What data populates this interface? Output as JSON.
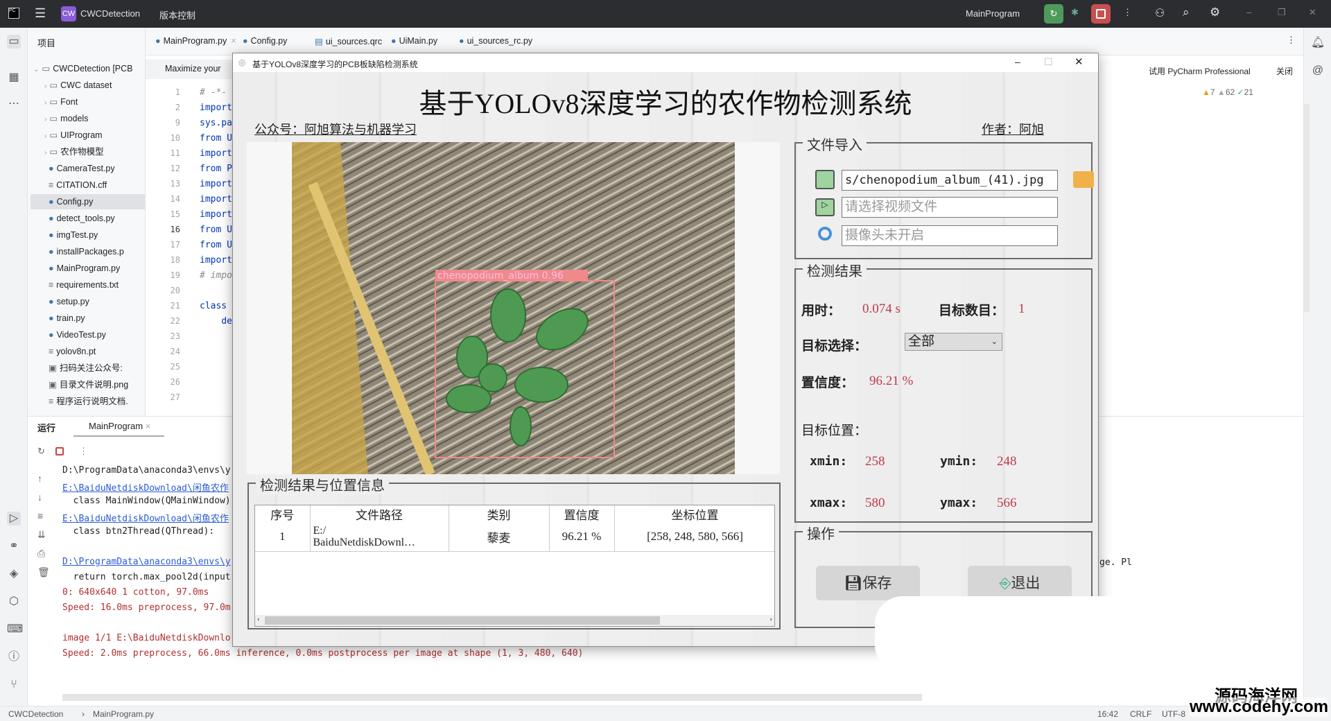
{
  "ide": {
    "project_name": "CWCDetection",
    "vcs": "版本控制",
    "run_config": "MainProgram",
    "project_label": "项目",
    "tree": [
      {
        "label": "CWCDetection [PCB",
        "kind": "root"
      },
      {
        "label": "CWC dataset",
        "kind": "folder"
      },
      {
        "label": "Font",
        "kind": "folder"
      },
      {
        "label": "models",
        "kind": "folder"
      },
      {
        "label": "UIProgram",
        "kind": "folder"
      },
      {
        "label": "农作物模型",
        "kind": "folder"
      },
      {
        "label": "CameraTest.py",
        "kind": "py"
      },
      {
        "label": "CITATION.cff",
        "kind": "txt"
      },
      {
        "label": "Config.py",
        "kind": "py"
      },
      {
        "label": "detect_tools.py",
        "kind": "py"
      },
      {
        "label": "imgTest.py",
        "kind": "py"
      },
      {
        "label": "installPackages.p",
        "kind": "py"
      },
      {
        "label": "MainProgram.py",
        "kind": "py"
      },
      {
        "label": "requirements.txt",
        "kind": "txt"
      },
      {
        "label": "setup.py",
        "kind": "py"
      },
      {
        "label": "train.py",
        "kind": "py"
      },
      {
        "label": "VideoTest.py",
        "kind": "py"
      },
      {
        "label": "yolov8n.pt",
        "kind": "txt"
      },
      {
        "label": "扫码关注公众号:",
        "kind": "img"
      },
      {
        "label": "目录文件说明.png",
        "kind": "img"
      },
      {
        "label": "程序运行说明文档.",
        "kind": "txt"
      }
    ],
    "tabs": [
      "MainProgram.py",
      "Config.py",
      "ui_sources.qrc",
      "UiMain.py",
      "ui_sources_rc.py"
    ],
    "banner": "Maximize your",
    "trial": "试用 PyCharm Professional",
    "close": "关闭",
    "inspections": {
      "warn1": "7",
      "warn2": "62",
      "ok": "21"
    },
    "code_lines": [
      {
        "n": "1",
        "c": "# -*-"
      },
      {
        "n": "2",
        "c": "import"
      },
      {
        "n": "9",
        "c": "sys.pa"
      },
      {
        "n": "10",
        "c": "from U"
      },
      {
        "n": "11",
        "c": "import"
      },
      {
        "n": "12",
        "c": "from P"
      },
      {
        "n": "13",
        "c": "import"
      },
      {
        "n": "14",
        "c": "import"
      },
      {
        "n": "15",
        "c": "import"
      },
      {
        "n": "16",
        "c": "from U"
      },
      {
        "n": "17",
        "c": "from U"
      },
      {
        "n": "18",
        "c": "import"
      },
      {
        "n": "19",
        "c": "# impo"
      },
      {
        "n": "20",
        "c": ""
      },
      {
        "n": "21",
        "c": "class"
      },
      {
        "n": "22",
        "c": "    de"
      },
      {
        "n": "23",
        "c": ""
      },
      {
        "n": "24",
        "c": ""
      },
      {
        "n": "25",
        "c": ""
      },
      {
        "n": "26",
        "c": ""
      },
      {
        "n": "27",
        "c": ""
      }
    ],
    "run_label": "运行",
    "run_tab": "MainProgram",
    "console": [
      {
        "t": "D:\\ProgramData\\anaconda3\\envs\\y",
        "k": ""
      },
      {
        "t": "E:\\BaiduNetdiskDownload\\闲鱼农作",
        "k": "link"
      },
      {
        "t": "  class MainWindow(QMainWindow)",
        "k": ""
      },
      {
        "t": "E:\\BaiduNetdiskDownload\\闲鱼农作",
        "k": "link"
      },
      {
        "t": "  class btn2Thread(QThread):",
        "k": ""
      },
      {
        "t": "",
        "k": ""
      },
      {
        "t": "D:\\ProgramData\\anaconda3\\envs\\y",
        "k": "link"
      },
      {
        "t": "  return torch.max_pool2d(input",
        "k": ""
      },
      {
        "t": "0: 640x640 1 cotton, 97.0ms",
        "k": "err"
      },
      {
        "t": "Speed: 16.0ms preprocess, 97.0m",
        "k": "err"
      },
      {
        "t": "",
        "k": ""
      },
      {
        "t": "image 1/1 E:\\BaiduNetdiskDownlo",
        "k": "err"
      },
      {
        "t": "Speed: 2.0ms preprocess, 66.0ms inference, 0.0ms postprocess per image at shape (1, 3, 480, 640)",
        "k": "err"
      }
    ],
    "console_right": "ge. Pl",
    "status": {
      "project": "CWCDetection",
      "file": "MainProgram.py",
      "pos": "16:42",
      "eol": "CRLF",
      "enc": "UTF-8"
    }
  },
  "app": {
    "window_title": "基于YOLOv8深度学习的PCB板缺陷检测系统",
    "title": "基于YOLOv8深度学习的农作物检测系统",
    "wechat": "公众号：阿旭算法与机器学习",
    "author": "作者：阿旭",
    "detection_label": "chenopodium_album  0.96",
    "file_group": "文件导入",
    "image_path": "s/chenopodium_album_(41).jpg",
    "video_placeholder": "请选择视频文件",
    "camera_placeholder": "摄像头未开启",
    "result_group": "检测结果",
    "time_label": "用时：",
    "time_value": "0.074 s",
    "count_label": "目标数目：",
    "count_value": "1",
    "select_label": "目标选择：",
    "select_value": "全部",
    "conf_label": "置信度：",
    "conf_value": "96.21 %",
    "pos_label": "目标位置：",
    "xmin_label": "xmin:",
    "xmin": "258",
    "ymin_label": "ymin:",
    "ymin": "248",
    "xmax_label": "xmax:",
    "xmax": "580",
    "ymax_label": "ymax:",
    "ymax": "566",
    "ops_group": "操作",
    "save": "保存",
    "exit": "退出",
    "table_group": "检测结果与位置信息",
    "columns": [
      "序号",
      "文件路径",
      "类别",
      "置信度",
      "坐标位置"
    ],
    "rows": [
      [
        "1",
        "E:/\nBaiduNetdiskDownl…",
        "藜麦",
        "96.21 %",
        "[258, 248, 580, 566]"
      ]
    ]
  },
  "watermark": {
    "name": "源码海洋网",
    "url": "www.codehy.com"
  }
}
